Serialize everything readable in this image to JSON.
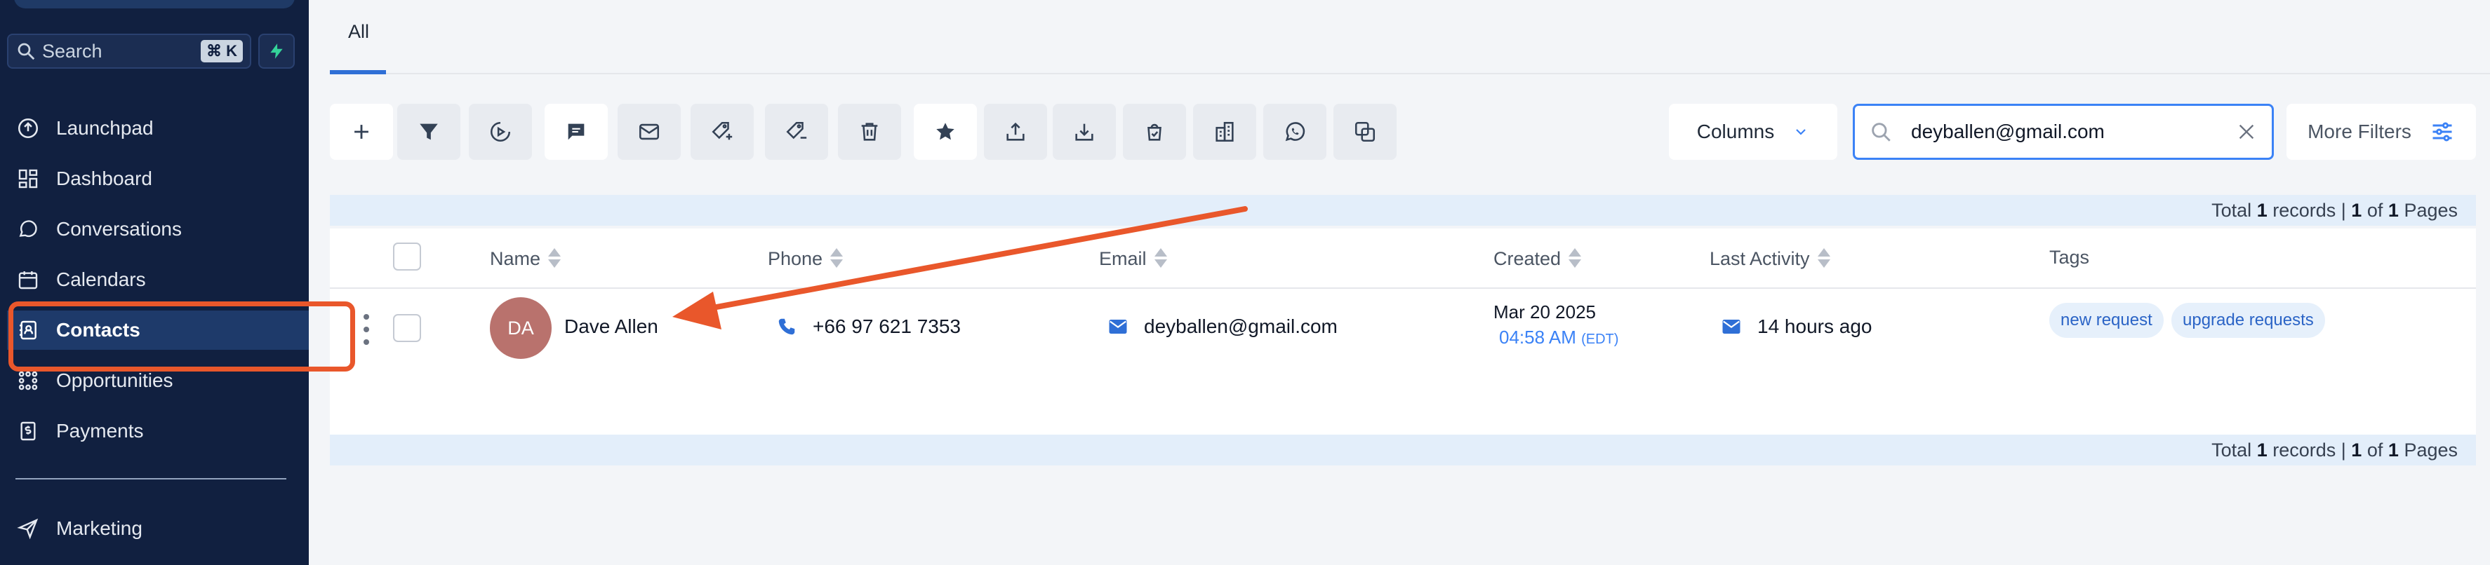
{
  "sidebar": {
    "search_label": "Search",
    "search_shortcut": "⌘ K",
    "items": [
      {
        "label": "Launchpad",
        "icon": "launchpad-icon"
      },
      {
        "label": "Dashboard",
        "icon": "dashboard-icon"
      },
      {
        "label": "Conversations",
        "icon": "chat-bubble-icon"
      },
      {
        "label": "Calendars",
        "icon": "calendar-icon"
      },
      {
        "label": "Contacts",
        "icon": "contacts-book-icon",
        "active": true
      },
      {
        "label": "Opportunities",
        "icon": "opportunities-icon"
      },
      {
        "label": "Payments",
        "icon": "payments-icon"
      },
      {
        "label": "Marketing",
        "icon": "send-icon"
      }
    ]
  },
  "tabs": [
    {
      "label": "All",
      "active": true
    }
  ],
  "toolbar": {
    "buttons": [
      "add-icon",
      "filter-icon",
      "automation-icon",
      "sms-icon",
      "email-icon",
      "add-tag-icon",
      "remove-tag-icon",
      "delete-icon",
      "star-icon",
      "export-icon",
      "import-icon",
      "review-request-icon",
      "company-icon",
      "whatsapp-icon",
      "merge-icon"
    ],
    "columns_label": "Columns",
    "search_value": "deyballen@gmail.com",
    "more_filters_label": "More Filters"
  },
  "records_info": {
    "prefix": "Total ",
    "total": "1",
    "mid": " records | ",
    "page": "1",
    "of": " of ",
    "pages": "1",
    "suffix": " Pages"
  },
  "table": {
    "columns": [
      "Name",
      "Phone",
      "Email",
      "Created",
      "Last Activity",
      "Tags"
    ],
    "rows": [
      {
        "initials": "DA",
        "name": "Dave Allen",
        "phone": "+66 97 621 7353",
        "email": "deyballen@gmail.com",
        "created_date": "Mar 20 2025",
        "created_time": "04:58 AM",
        "created_tz": "(EDT)",
        "last_activity": "14 hours ago",
        "tags": [
          "new request",
          "upgrade requests"
        ]
      }
    ]
  },
  "colors": {
    "sidebar_bg": "#112040",
    "accent": "#2f6fd6",
    "annotation": "#e9572b",
    "avatar": "#b9726d"
  }
}
